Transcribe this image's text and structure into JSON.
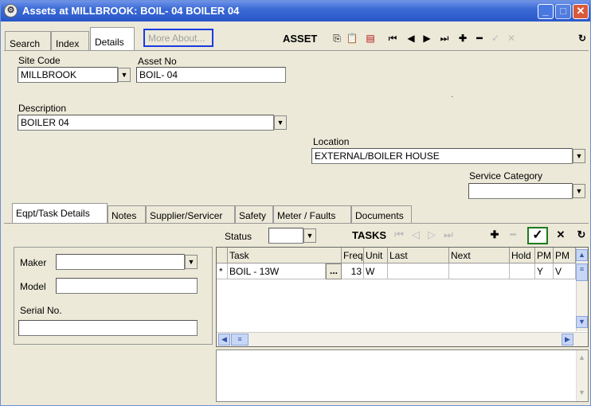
{
  "window": {
    "title": "Assets at MILLBROOK: BOIL- 04 BOILER 04",
    "app_icon": "gear-icon",
    "minimize_icon": "minimize-icon",
    "maximize_icon": "maximize-icon",
    "close_icon": "close-icon"
  },
  "top_tabs": [
    {
      "label": "Search"
    },
    {
      "label": "Index"
    },
    {
      "label": "Details"
    }
  ],
  "more_about": "More About...",
  "toolbar": {
    "label": "ASSET",
    "buttons": [
      "copy-icon",
      "paste-icon",
      "clipboard-icon",
      "first-record-icon",
      "previous-record-icon",
      "next-record-icon",
      "last-record-icon",
      "add-icon",
      "delete-icon",
      "confirm-icon",
      "cancel-icon",
      "refresh-icon"
    ]
  },
  "form": {
    "site_code_label": "Site Code",
    "site_code_value": "MILLBROOK",
    "asset_no_label": "Asset No",
    "asset_no_value": "BOIL- 04",
    "description_label": "Description",
    "description_value": "BOILER 04",
    "location_label": "Location",
    "location_value": "EXTERNAL/BOILER HOUSE",
    "service_category_label": "Service Category",
    "service_category_value": "",
    "dot": "."
  },
  "sub_tabs": [
    {
      "label": "Eqpt/Task Details"
    },
    {
      "label": "Notes"
    },
    {
      "label": "Supplier/Servicer"
    },
    {
      "label": "Safety"
    },
    {
      "label": "Meter / Faults"
    },
    {
      "label": "Documents"
    }
  ],
  "tasks_section": {
    "status_label": "Status",
    "status_value": "",
    "tasks_label": "TASKS",
    "grid_headers": [
      "Task",
      "Freq",
      "Unit",
      "Last",
      "Next",
      "Hold",
      "PM",
      "PM"
    ],
    "rows": [
      {
        "marker": "*",
        "task": "BOIL - 13W",
        "lookup": "...",
        "freq": "13",
        "unit": "W",
        "last": "",
        "next": "",
        "hold": "",
        "pm": "Y",
        "pm2": "V"
      }
    ]
  },
  "equipment": {
    "maker_label": "Maker",
    "maker_value": "",
    "model_label": "Model",
    "model_value": "",
    "serial_label": "Serial No.",
    "serial_value": ""
  },
  "colors": {
    "title_bar": "#2a57c9",
    "more_about_border": "#1a3be0",
    "check_border": "#1e7a1e"
  }
}
